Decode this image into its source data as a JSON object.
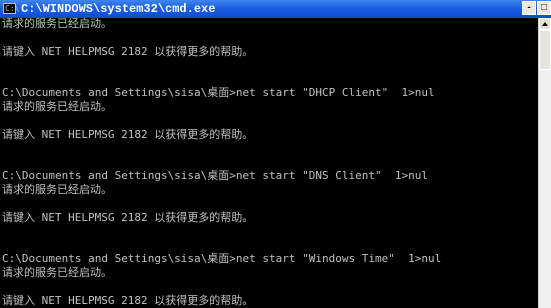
{
  "window": {
    "title": "C:\\WINDOWS\\system32\\cmd.exe",
    "icon_label": "C:\\",
    "buttons": {
      "minimize": "-",
      "maximize": "□"
    }
  },
  "console": {
    "lines": [
      "请求的服务已经启动。",
      "",
      "请键入 NET HELPMSG 2182 以获得更多的帮助。",
      "",
      "",
      "C:\\Documents and Settings\\sisa\\桌面>net start \"DHCP Client\"  1>nul",
      "请求的服务已经启动。",
      "",
      "请键入 NET HELPMSG 2182 以获得更多的帮助。",
      "",
      "",
      "C:\\Documents and Settings\\sisa\\桌面>net start \"DNS Client\"  1>nul",
      "请求的服务已经启动。",
      "",
      "请键入 NET HELPMSG 2182 以获得更多的帮助。",
      "",
      "",
      "C:\\Documents and Settings\\sisa\\桌面>net start \"Windows Time\"  1>nul",
      "请求的服务已经启动。",
      "",
      "请键入 NET HELPMSG 2182 以获得更多的帮助。"
    ]
  },
  "colors": {
    "console_bg": "#000000",
    "console_text": "#c0c0c0",
    "titlebar": "#0a4bd6"
  },
  "icons": {
    "app": "cmd-icon",
    "minimize": "minimize-icon",
    "maximize": "maximize-icon",
    "scroll_up": "scroll-up-arrow-icon"
  }
}
